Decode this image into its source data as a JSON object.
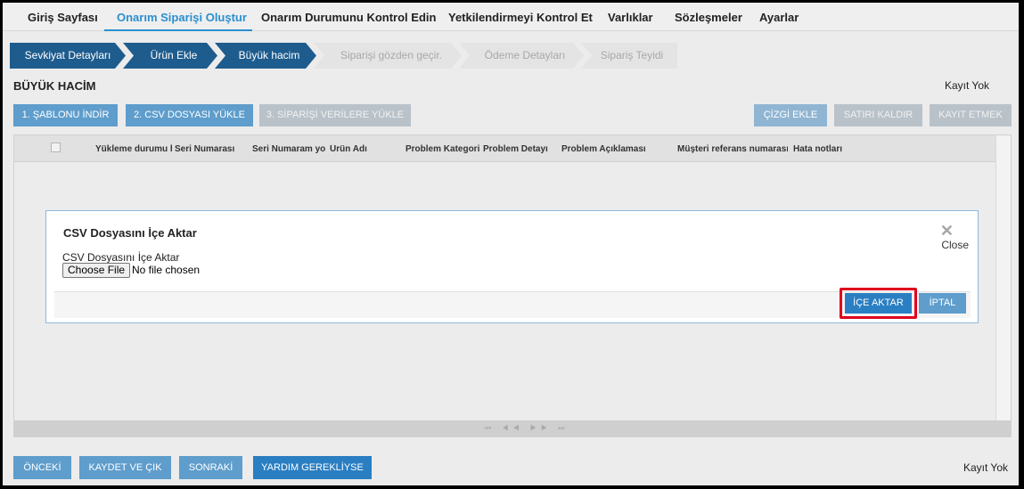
{
  "topnav": {
    "items": [
      {
        "label": "Giriş Sayfası"
      },
      {
        "label": "Onarım Siparişi Oluştur"
      },
      {
        "label": "Onarım Durumunu Kontrol Edin"
      },
      {
        "label": "Yetkilendirmeyi Kontrol Et"
      },
      {
        "label": "Varlıklar"
      },
      {
        "label": "Sözleşmeler"
      },
      {
        "label": "Ayarlar"
      }
    ],
    "active_index": 1
  },
  "steps": [
    {
      "label": "Sevkiyat Detayları",
      "state": "done"
    },
    {
      "label": "Ürün Ekle",
      "state": "done"
    },
    {
      "label": "Büyük hacim",
      "state": "done"
    },
    {
      "label": "Siparişi gözden geçir.",
      "state": "todo"
    },
    {
      "label": "Ödeme Detayları",
      "state": "todo"
    },
    {
      "label": "Sipariş Teyidi",
      "state": "todo"
    }
  ],
  "section": {
    "title": "BÜYÜK HACİM",
    "record_status": "Kayıt Yok"
  },
  "toolbar": {
    "download_template": "1. ŞABLONU İNDİR",
    "upload_csv": "2. CSV DOSYASI YÜKLE",
    "upload_to_order": "3. SİPARİŞİ VERİLERE YÜKLE",
    "add_line": "ÇİZGİ EKLE",
    "remove_row": "SATIRI KALDIR",
    "save_record": "KAYIT ETMEK"
  },
  "grid": {
    "columns": [
      "Yükleme durumu bil",
      "Seri Numarası",
      "Seri Numaram yok",
      "Ürün Adı",
      "Problem Kategorisi",
      "Problem Detayı",
      "Problem Açıklaması",
      "Müşteri referans numarası",
      "Hata notları"
    ],
    "rows": [],
    "pager": "⏮ ◀◀ ▶▶ ⏭"
  },
  "modal": {
    "title": "CSV Dosyasını İçe Aktar",
    "close_label": "Close",
    "close_icon": "✕",
    "file_label": "CSV Dosyasını İçe Aktar",
    "choose_file": "Choose File",
    "no_file": "No file chosen",
    "import_button": "İÇE AKTAR",
    "cancel_button": "İPTAL"
  },
  "footer": {
    "previous": "ÖNCEKİ",
    "save_exit": "KAYDET VE ÇIK",
    "next": "SONRAKİ",
    "help": "YARDIM GEREKLİYSE",
    "record_status": "Kayıt Yok"
  },
  "colors": {
    "accent": "#2a8fd0",
    "step_done": "#1e5c8e",
    "highlight": "#e0001b"
  }
}
